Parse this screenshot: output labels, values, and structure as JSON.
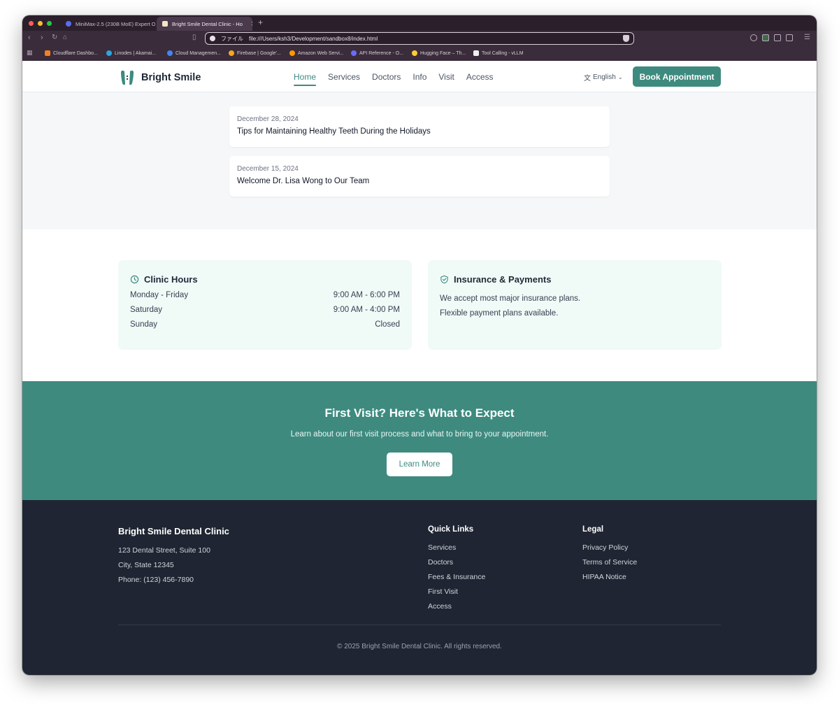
{
  "browser": {
    "tabs": [
      {
        "title": "MiniMax-2.5 (230B MoE) Expert O",
        "active": false
      },
      {
        "title": "Bright Smile Dental Clinic - Ho",
        "active": true
      }
    ],
    "url_prefix": "ファイル",
    "url": "file:///Users/ksh3/Development/sandbox8/index.html",
    "bookmarks": [
      "Cloudflare Dashbo...",
      "Linodes | Akamai...",
      "Cloud Managemen...",
      "Firebase | Google'...",
      "Amazon Web Servi...",
      "API Reference - O...",
      "Hugging Face – Th...",
      "Tool Calling - vLLM"
    ]
  },
  "header": {
    "brand": "Bright Smile",
    "nav": [
      "Home",
      "Services",
      "Doctors",
      "Info",
      "Visit",
      "Access"
    ],
    "language": "English",
    "book_label": "Book Appointment"
  },
  "news": [
    {
      "date": "December 28, 2024",
      "title": "Tips for Maintaining Healthy Teeth During the Holidays"
    },
    {
      "date": "December 15, 2024",
      "title": "Welcome Dr. Lisa Wong to Our Team"
    }
  ],
  "hours": {
    "title": "Clinic Hours",
    "rows": [
      {
        "day": "Monday - Friday",
        "time": "9:00 AM - 6:00 PM"
      },
      {
        "day": "Saturday",
        "time": "9:00 AM - 4:00 PM"
      },
      {
        "day": "Sunday",
        "time": "Closed"
      }
    ]
  },
  "insurance": {
    "title": "Insurance & Payments",
    "lines": [
      "We accept most major insurance plans.",
      "Flexible payment plans available."
    ]
  },
  "cta": {
    "title": "First Visit? Here's What to Expect",
    "subtitle": "Learn about our first visit process and what to bring to your appointment.",
    "button": "Learn More"
  },
  "footer": {
    "clinic_name": "Bright Smile Dental Clinic",
    "address_lines": [
      "123 Dental Street, Suite 100",
      "City, State 12345",
      "Phone: (123) 456-7890"
    ],
    "quick_links_title": "Quick Links",
    "quick_links": [
      "Services",
      "Doctors",
      "Fees & Insurance",
      "First Visit",
      "Access"
    ],
    "legal_title": "Legal",
    "legal_links": [
      "Privacy Policy",
      "Terms of Service",
      "HIPAA Notice"
    ],
    "copyright": "© 2025 Bright Smile Dental Clinic. All rights reserved."
  },
  "colors": {
    "brand": "#3e8a7f",
    "footer_bg": "#1f2532",
    "card_bg": "#f0faf7"
  }
}
